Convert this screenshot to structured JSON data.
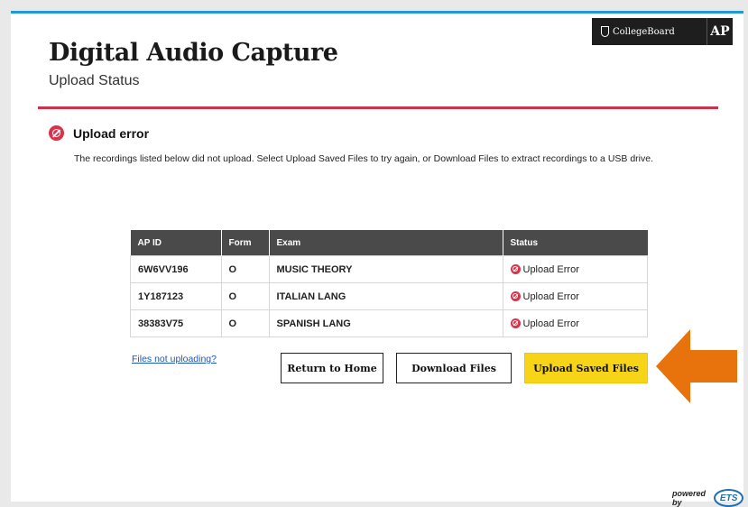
{
  "header": {
    "title": "Digital Audio Capture",
    "subtitle": "Upload Status"
  },
  "brand": {
    "collegeboard": "CollegeBoard",
    "ap": "AP"
  },
  "error": {
    "title": "Upload error",
    "message": "The recordings listed below did not upload. Select Upload Saved Files to try again, or Download Files to extract recordings to a USB drive."
  },
  "table": {
    "headers": [
      "AP ID",
      "Form",
      "Exam",
      "Status"
    ],
    "rows": [
      {
        "ap_id": "6W6VV196",
        "form": "O",
        "exam": "MUSIC THEORY",
        "status": "Upload Error"
      },
      {
        "ap_id": "1Y187123",
        "form": "O",
        "exam": "ITALIAN LANG",
        "status": "Upload Error"
      },
      {
        "ap_id": "38383V75",
        "form": "O",
        "exam": "SPANISH LANG",
        "status": "Upload Error"
      }
    ]
  },
  "actions": {
    "help_link": "Files not uploading?",
    "return_home": "Return to Home",
    "download": "Download Files",
    "upload": "Upload Saved Files"
  },
  "footer": {
    "powered_by": "powered by",
    "ets": "ETS"
  },
  "colors": {
    "accent_blue": "#1f9ad6",
    "divider_red": "#c8344a",
    "error_red": "#d7334a",
    "upload_yellow": "#f7d417",
    "arrow_orange": "#e8720c"
  }
}
